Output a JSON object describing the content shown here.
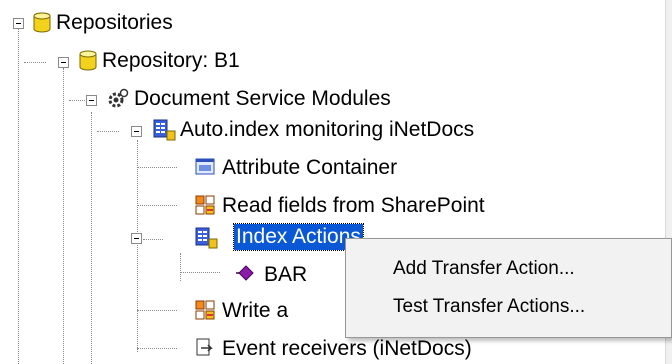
{
  "tree": {
    "items": [
      {
        "label": "Repositories",
        "icon": "database-icon"
      },
      {
        "label": "Repository: B1",
        "icon": "database-icon"
      },
      {
        "label": "Document Service Modules",
        "icon": "service-gear-icon"
      },
      {
        "label": "Auto.index monitoring iNetDocs",
        "icon": "module-icon"
      },
      {
        "label": "Attribute Container",
        "icon": "container-icon"
      },
      {
        "label": "Read fields from SharePoint",
        "icon": "field-mapping-icon"
      },
      {
        "label": "Index Actions",
        "icon": "module-icon",
        "selected": true
      },
      {
        "label": "BAR",
        "icon": "action-diamond-icon"
      },
      {
        "label": "Write a",
        "icon": "field-mapping-icon"
      },
      {
        "label": "Event receivers (iNetDocs)",
        "icon": "event-receiver-icon"
      }
    ]
  },
  "context_menu": {
    "items": [
      {
        "label": "Add Transfer Action..."
      },
      {
        "label": "Test Transfer Actions..."
      }
    ]
  },
  "colors": {
    "selection": "#0a58d6",
    "menu_background": "#f2f2f2"
  }
}
